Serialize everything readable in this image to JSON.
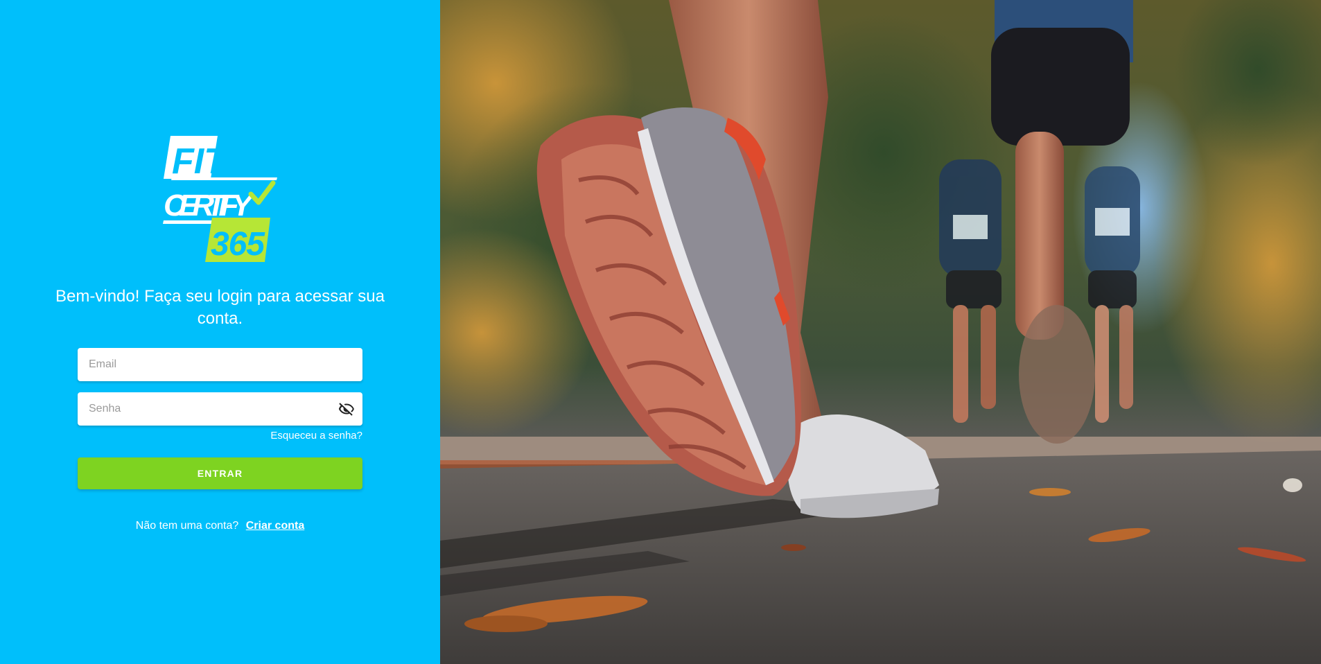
{
  "logo": {
    "line1": "FIT",
    "line2": "CERTIFY",
    "line3": "365",
    "check_icon": "check-icon"
  },
  "welcome_text": "Bem-vindo! Faça seu login para acessar sua conta.",
  "form": {
    "email_placeholder": "Email",
    "email_value": "",
    "password_placeholder": "Senha",
    "password_value": "",
    "toggle_icon": "eye-off-icon",
    "forgot_password": "Esqueceu a senha?",
    "submit_label": "ENTRAR"
  },
  "signup": {
    "prompt": "Não tem uma conta?",
    "link": "Criar conta"
  },
  "colors": {
    "panel_bg": "#00bffb",
    "button_bg": "#7ed321",
    "logo_accent": "#b6e636"
  },
  "hero": {
    "alt": "runners on a road, close-up of running shoe"
  }
}
